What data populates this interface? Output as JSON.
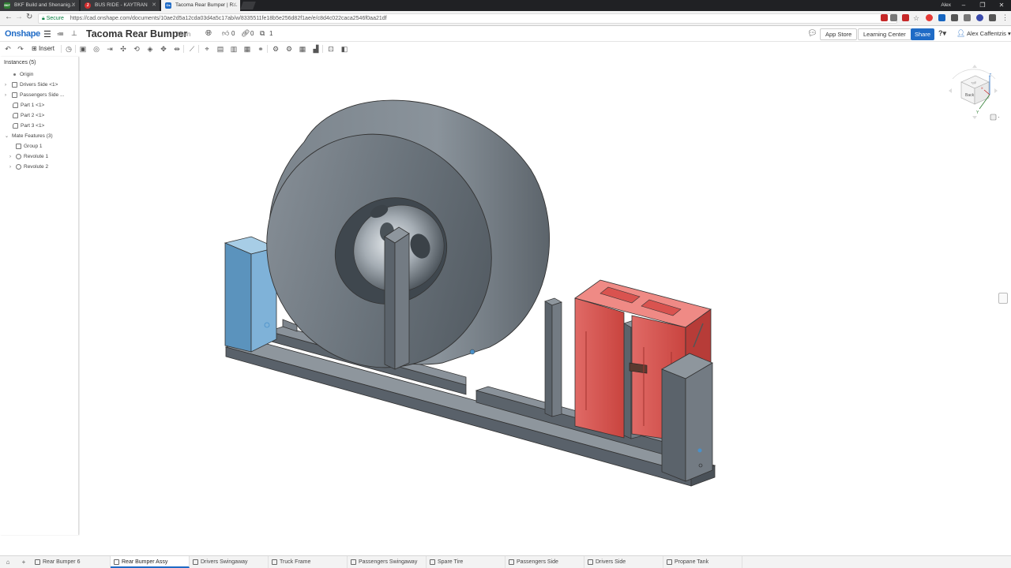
{
  "browser": {
    "tabs": [
      {
        "label": "BKF Build and Shenanig...",
        "favicon_color": "#2e7d32",
        "favicon": "BKF",
        "active": false
      },
      {
        "label": "BUS RIDE - KAYTRAN",
        "favicon_color": "#d32f2f",
        "favicon": "J",
        "active": false
      },
      {
        "label": "Tacoma Rear Bumper | R...",
        "favicon_color": "#1f6bc6",
        "favicon": "Os",
        "active": true
      }
    ],
    "window_user": "Alex",
    "secure_label": "Secure",
    "url": "https://cad.onshape.com/documents/10ae2d5a12cda03d4a5c17ab/w/8335511fe18b5e256d82f1ae/e/c8d4c022caca2546f0aa21df"
  },
  "header": {
    "logo": "Onshape",
    "doc_title": "Tacoma Rear Bumper",
    "workspace": "Main",
    "likes": "0",
    "links": "0",
    "versions": "1",
    "app_store": "App Store",
    "learning_center": "Learning Center",
    "share": "Share",
    "help": "?",
    "user": "Alex Caffentzis"
  },
  "toolbar": {
    "insert_label": "Insert"
  },
  "instances": {
    "title": "Instances (5)",
    "rows": [
      {
        "label": "Origin",
        "indent": 1,
        "caret": ""
      },
      {
        "label": "Drivers Side <1>",
        "indent": 1,
        "caret": "›"
      },
      {
        "label": "Passengers Side ...",
        "indent": 1,
        "caret": "›"
      },
      {
        "label": "Part 1 <1>",
        "indent": 1,
        "caret": ""
      },
      {
        "label": "Part 2 <1>",
        "indent": 1,
        "caret": ""
      },
      {
        "label": "Part 3 <1>",
        "indent": 1,
        "caret": ""
      },
      {
        "label": "Mate Features (3)",
        "indent": 0,
        "caret": "⌄"
      },
      {
        "label": "Group 1",
        "indent": 2,
        "caret": ""
      },
      {
        "label": "Revolute 1",
        "indent": 2,
        "caret": "›"
      },
      {
        "label": "Revolute 2",
        "indent": 2,
        "caret": "›"
      }
    ]
  },
  "viewcube": {
    "face_label": "Back",
    "top_label": "Top",
    "axis_z": "Z",
    "axis_y": "Y",
    "axis_x": "X"
  },
  "bottom_tabs": [
    {
      "label": "Rear Bumper 6",
      "active": false
    },
    {
      "label": "Rear Bumper Assy",
      "active": true
    },
    {
      "label": "Drivers Swingaway",
      "active": false
    },
    {
      "label": "Truck Frame",
      "active": false
    },
    {
      "label": "Passengers Swingaway",
      "active": false
    },
    {
      "label": "Spare Tire",
      "active": false
    },
    {
      "label": "Passengers Side",
      "active": false
    },
    {
      "label": "Drivers Side",
      "active": false
    },
    {
      "label": "Propane Tank",
      "active": false
    }
  ],
  "colors": {
    "accent": "#1f6bc6",
    "steel": "#5d666e",
    "tire": "#6c757d",
    "selected_post": "#7fb2d8",
    "jerry_can": "#d9534f"
  }
}
